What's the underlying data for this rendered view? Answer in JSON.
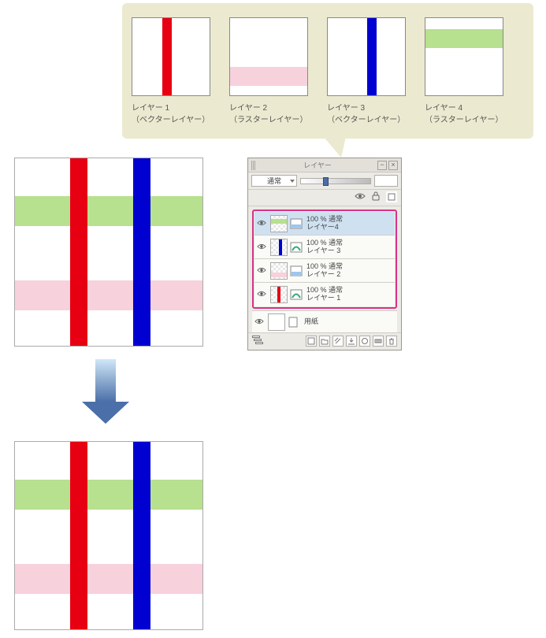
{
  "gallery": {
    "items": [
      {
        "title": "レイヤー 1",
        "type": "（ベクターレイヤー）"
      },
      {
        "title": "レイヤー 2",
        "type": "（ラスターレイヤー）"
      },
      {
        "title": "レイヤー 3",
        "type": "（ベクターレイヤー）"
      },
      {
        "title": "レイヤー 4",
        "type": "（ラスターレイヤー）"
      }
    ]
  },
  "palette": {
    "title": "レイヤー",
    "blend_mode": "通常",
    "layers": [
      {
        "sub": "100 % 通常",
        "name": "レイヤー4"
      },
      {
        "sub": "100 % 通常",
        "name": "レイヤー 3"
      },
      {
        "sub": "100 % 通常",
        "name": "レイヤー 2"
      },
      {
        "sub": "100 % 通常",
        "name": "レイヤー 1"
      }
    ],
    "paper": {
      "name": "用紙"
    }
  },
  "colors": {
    "red": "#e60012",
    "blue": "#0000d0",
    "pink": "#f7d1dc",
    "green": "#b7e08f",
    "selection": "#d63384"
  }
}
